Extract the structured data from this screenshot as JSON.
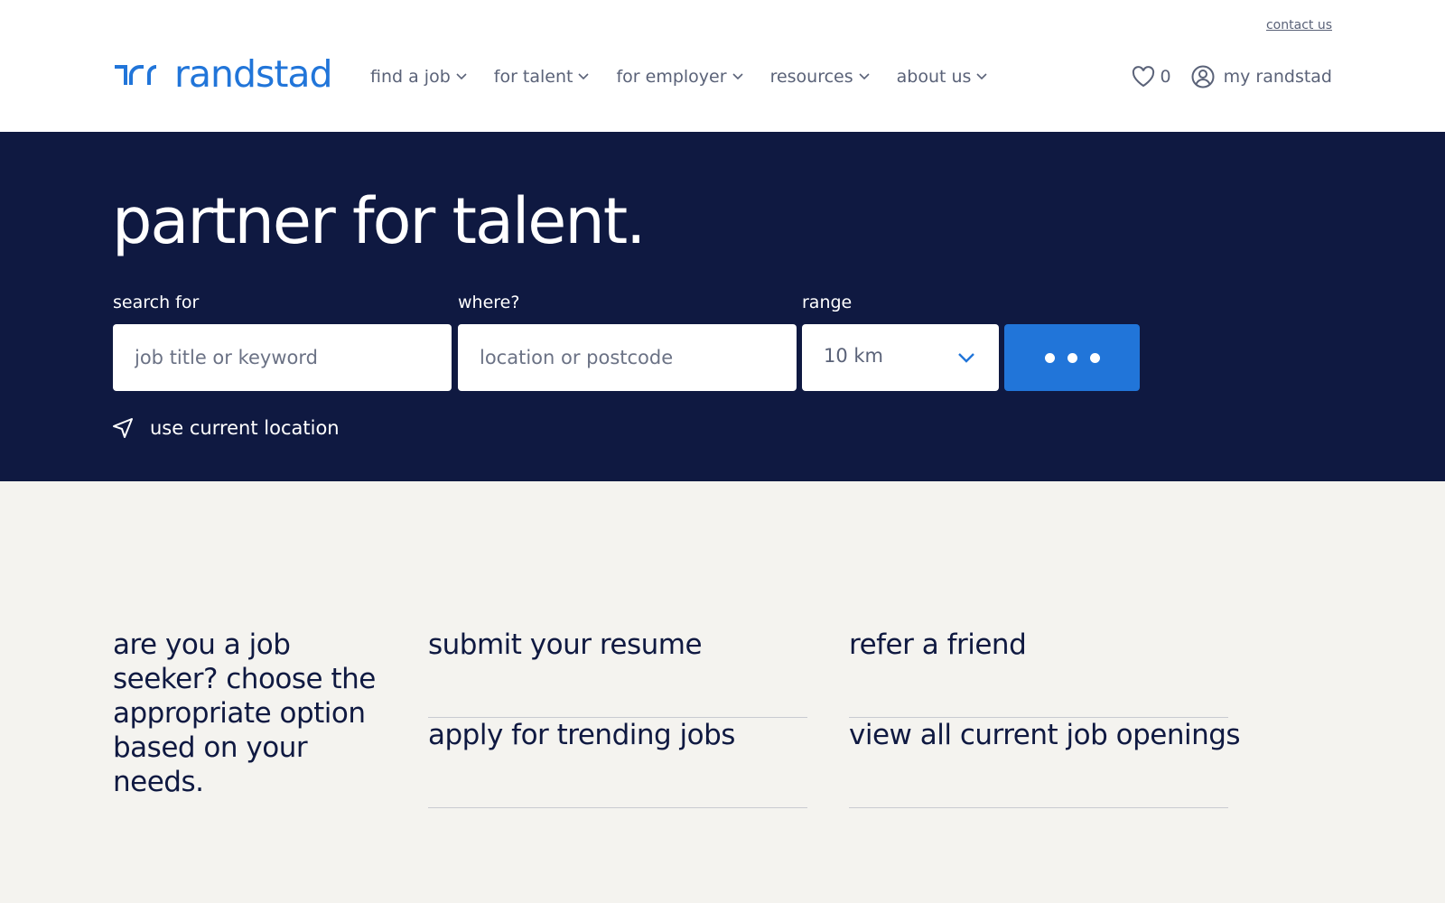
{
  "header": {
    "contact_label": "contact us",
    "logo_text": "randstad",
    "nav": [
      {
        "label": "find a job"
      },
      {
        "label": "for talent"
      },
      {
        "label": "for employer"
      },
      {
        "label": "resources"
      },
      {
        "label": "about us"
      }
    ],
    "favorites_count": "0",
    "account_label": "my randstad"
  },
  "hero": {
    "title": "partner for talent.",
    "search": {
      "label": "search for",
      "placeholder": "job title or keyword"
    },
    "where": {
      "label": "where?",
      "placeholder": "location or postcode"
    },
    "range": {
      "label": "range",
      "value": "10 km"
    },
    "use_location_label": "use current location"
  },
  "seeker": {
    "intro": "are you a job seeker? choose the appropriate option based on your needs.",
    "options": [
      {
        "label": "submit your resume"
      },
      {
        "label": "refer a friend"
      },
      {
        "label": "apply for trending jobs"
      },
      {
        "label": "view all current job openings"
      }
    ]
  },
  "colors": {
    "brand_blue": "#2175d9",
    "navy": "#0f1941",
    "page_bg": "#f4f3ef"
  }
}
